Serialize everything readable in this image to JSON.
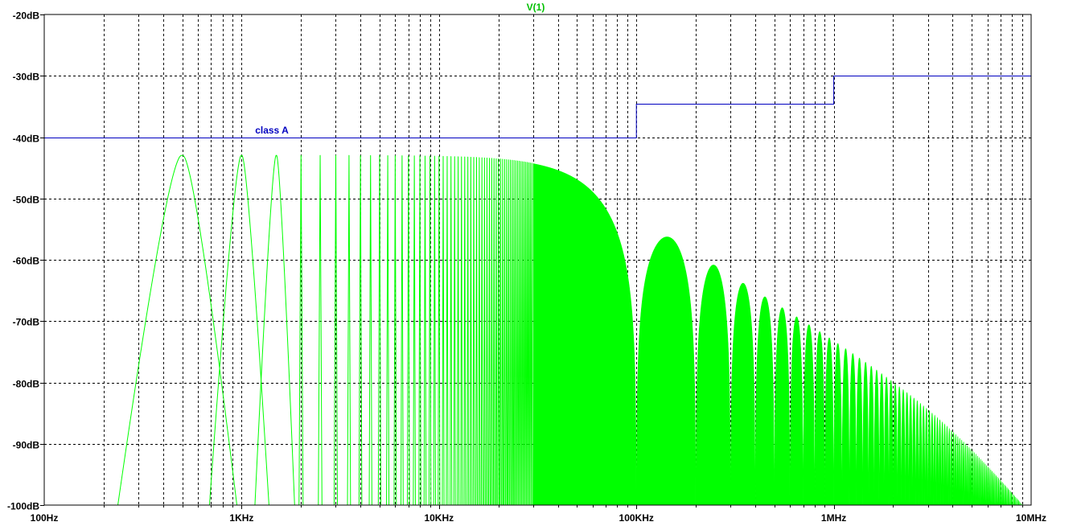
{
  "chart_data": {
    "type": "line",
    "title": "V(1)",
    "title_color": "#00c000",
    "xscale": "log",
    "xlim": [
      100,
      10000000
    ],
    "ylim": [
      -100,
      -20
    ],
    "grid": true,
    "x_ticks": [
      {
        "v": 100,
        "label": "100Hz"
      },
      {
        "v": 1000,
        "label": "1KHz"
      },
      {
        "v": 10000,
        "label": "10KHz"
      },
      {
        "v": 100000,
        "label": "100KHz"
      },
      {
        "v": 1000000,
        "label": "1MHz"
      },
      {
        "v": 10000000,
        "label": "10MHz"
      }
    ],
    "y_ticks": [
      {
        "v": -20,
        "label": "-20dB"
      },
      {
        "v": -30,
        "label": "-30dB"
      },
      {
        "v": -40,
        "label": "-40dB"
      },
      {
        "v": -50,
        "label": "-50dB"
      },
      {
        "v": -60,
        "label": "-60dB"
      },
      {
        "v": -70,
        "label": "-70dB"
      },
      {
        "v": -80,
        "label": "-80dB"
      },
      {
        "v": -90,
        "label": "-90dB"
      },
      {
        "v": -100,
        "label": "-100dB"
      }
    ],
    "series": [
      {
        "name": "V(1)",
        "color": "#00ff00",
        "kind": "harmonic spectrum",
        "fundamental_hz": 500,
        "peak_db": -43,
        "first_null_hz": 100000,
        "rolloff_corner_hz": 4000000
      },
      {
        "name": "class A",
        "color": "#0000c0",
        "kind": "step limit",
        "points": [
          [
            100,
            -40
          ],
          [
            100000,
            -40
          ],
          [
            100000,
            -34.5
          ],
          [
            1000000,
            -34.5
          ],
          [
            1000000,
            -30
          ],
          [
            10000000,
            -30
          ]
        ]
      }
    ],
    "annotations": [
      {
        "text": "class A",
        "x": 2000,
        "y": -40
      }
    ]
  }
}
